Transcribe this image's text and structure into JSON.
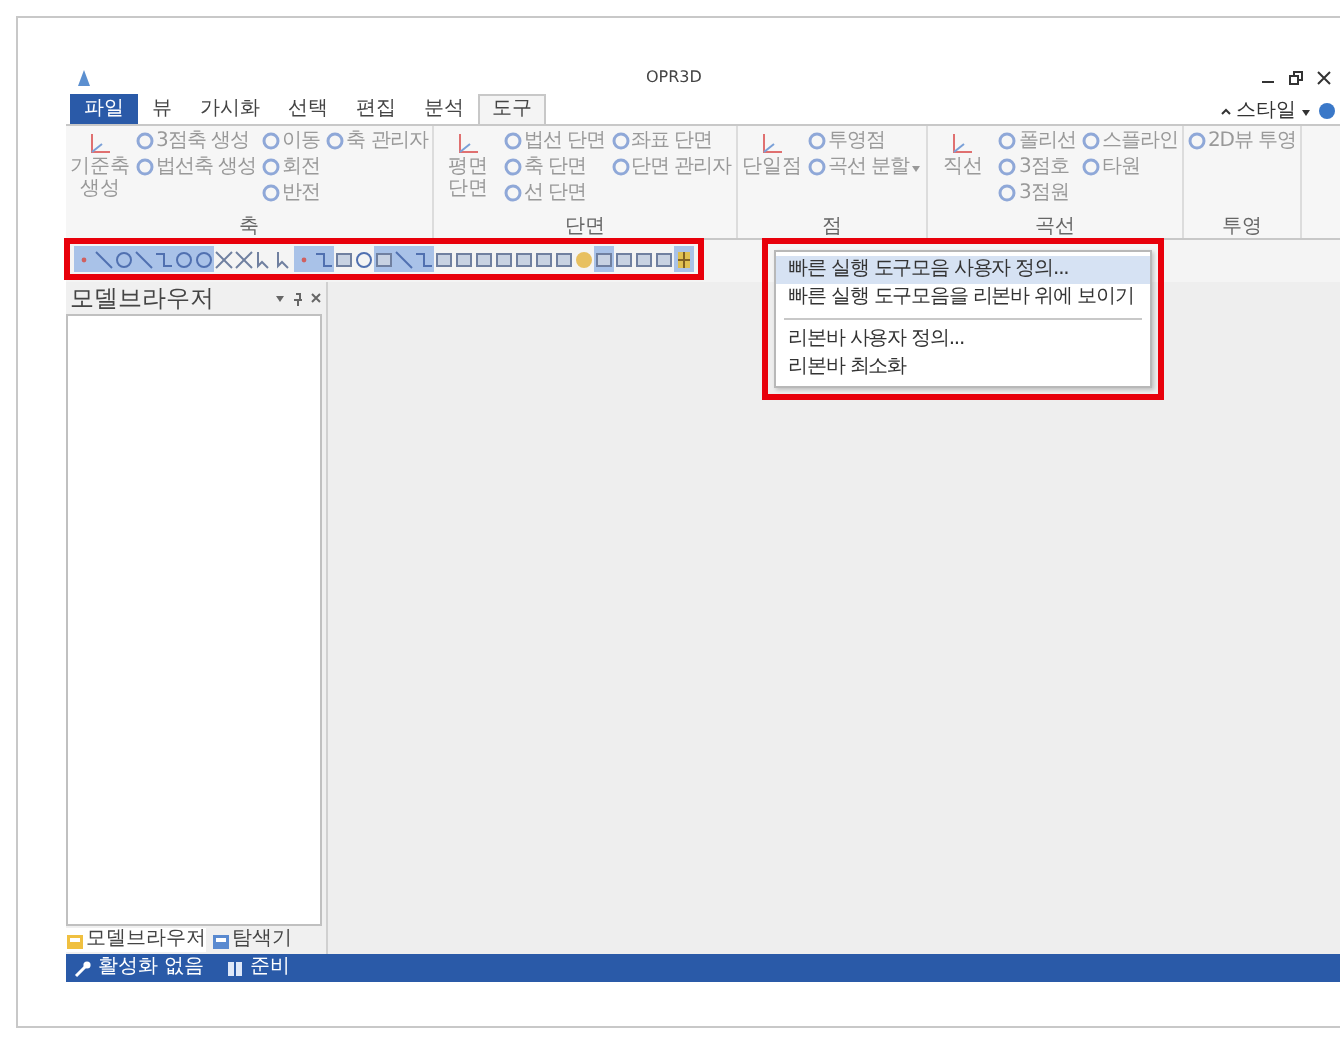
{
  "window": {
    "title": "OPR3D"
  },
  "ribbon_tabs": [
    {
      "label": "파일",
      "kind": "file",
      "selected": false
    },
    {
      "label": "뷰",
      "kind": "tab",
      "selected": false
    },
    {
      "label": "가시화",
      "kind": "tab",
      "selected": false
    },
    {
      "label": "선택",
      "kind": "tab",
      "selected": false
    },
    {
      "label": "편집",
      "kind": "tab",
      "selected": false
    },
    {
      "label": "분석",
      "kind": "tab",
      "selected": false
    },
    {
      "label": "도구",
      "kind": "tab",
      "selected": true
    }
  ],
  "style_menu": {
    "label": "스타일"
  },
  "ribbon_groups": [
    {
      "label": "축",
      "columns": [
        [
          {
            "label": "기준축 생성",
            "kind": "large"
          }
        ],
        [
          {
            "label": "3점축 생성",
            "kind": "small"
          },
          {
            "label": "법선축 생성",
            "kind": "small"
          }
        ],
        [
          {
            "label": "이동",
            "kind": "small"
          },
          {
            "label": "회전",
            "kind": "small"
          },
          {
            "label": "반전",
            "kind": "small"
          }
        ],
        [
          {
            "label": "축 관리자",
            "kind": "small"
          }
        ]
      ]
    },
    {
      "label": "단면",
      "columns": [
        [
          {
            "label": "평면 단면",
            "kind": "large"
          }
        ],
        [
          {
            "label": "법선 단면",
            "kind": "small"
          },
          {
            "label": "축 단면",
            "kind": "small"
          },
          {
            "label": "선 단면",
            "kind": "small"
          }
        ],
        [
          {
            "label": "좌표 단면",
            "kind": "small"
          },
          {
            "label": "단면 관리자",
            "kind": "small"
          }
        ]
      ]
    },
    {
      "label": "점",
      "columns": [
        [
          {
            "label": "단일점",
            "kind": "large"
          }
        ],
        [
          {
            "label": "투영점",
            "kind": "small"
          },
          {
            "label": "곡선 분할",
            "kind": "small",
            "dropdown": true
          }
        ]
      ]
    },
    {
      "label": "곡선",
      "columns": [
        [
          {
            "label": "직선",
            "kind": "large"
          }
        ],
        [
          {
            "label": "폴리선",
            "kind": "small"
          },
          {
            "label": "3점호",
            "kind": "small"
          },
          {
            "label": "3점원",
            "kind": "small"
          }
        ],
        [
          {
            "label": "스플라인",
            "kind": "small"
          },
          {
            "label": "타원",
            "kind": "small"
          }
        ]
      ]
    },
    {
      "label": "투영",
      "columns": [
        [
          {
            "label": "2D뷰 투영",
            "kind": "small"
          }
        ]
      ]
    }
  ],
  "quick_access_toolbar": {
    "highlighted": true,
    "items": [
      {
        "kind": "point",
        "on": true
      },
      {
        "kind": "line",
        "on": true
      },
      {
        "kind": "circle",
        "on": true
      },
      {
        "kind": "line",
        "on": true
      },
      {
        "kind": "polyline",
        "on": true
      },
      {
        "kind": "circle",
        "on": true
      },
      {
        "kind": "circle",
        "on": true
      },
      {
        "kind": "cross",
        "on": false
      },
      {
        "kind": "cross",
        "on": false
      },
      {
        "kind": "arrow",
        "on": false
      },
      {
        "kind": "arrow",
        "on": false
      },
      {
        "kind": "point",
        "on": true
      },
      {
        "kind": "polyline",
        "on": true
      },
      {
        "kind": "box",
        "on": false
      },
      {
        "kind": "circle",
        "on": false
      },
      {
        "kind": "box",
        "on": true
      },
      {
        "kind": "line",
        "on": true
      },
      {
        "kind": "polyline",
        "on": true
      },
      {
        "kind": "box",
        "on": false
      },
      {
        "kind": "box",
        "on": false
      },
      {
        "kind": "box",
        "on": false
      },
      {
        "kind": "box",
        "on": false
      },
      {
        "kind": "box",
        "on": false
      },
      {
        "kind": "box",
        "on": false
      },
      {
        "kind": "box",
        "on": false
      },
      {
        "kind": "sphere",
        "on": false
      },
      {
        "kind": "box",
        "on": true
      },
      {
        "kind": "box",
        "on": false
      },
      {
        "kind": "box",
        "on": false
      },
      {
        "kind": "box",
        "on": false
      },
      {
        "kind": "grid",
        "on": true
      }
    ]
  },
  "context_menu": {
    "highlighted": true,
    "items": [
      {
        "kind": "item",
        "label": "빠른 실행 도구모음 사용자 정의...",
        "selected": true
      },
      {
        "kind": "item",
        "label": "빠른 실행 도구모음을 리본바 위에 보이기",
        "selected": false
      },
      {
        "kind": "separator"
      },
      {
        "kind": "item",
        "label": "리본바 사용자 정의...",
        "selected": false
      },
      {
        "kind": "item",
        "label": "리본바 최소화",
        "selected": false
      }
    ]
  },
  "model_browser": {
    "title": "모델브라우저"
  },
  "panel_tabs": [
    {
      "label": "모델브라우저",
      "selected": true
    },
    {
      "label": "탐색기",
      "selected": false
    }
  ],
  "status_bar": {
    "items": [
      {
        "label": "활성화 없음",
        "kind": "tool"
      },
      {
        "label": "준비",
        "kind": "book"
      }
    ]
  }
}
